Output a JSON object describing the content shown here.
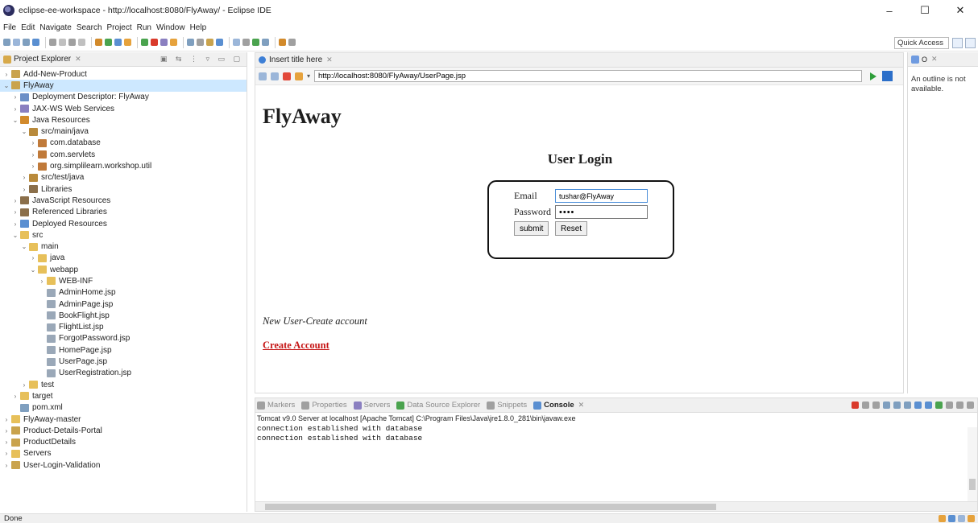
{
  "window": {
    "title": "eclipse-ee-workspace - http://localhost:8080/FlyAway/ - Eclipse IDE",
    "minimize": "–",
    "maximize": "☐",
    "close": "✕"
  },
  "menu": [
    "File",
    "Edit",
    "Navigate",
    "Search",
    "Project",
    "Run",
    "Window",
    "Help"
  ],
  "toolbar": {
    "quick_access": "Quick Access"
  },
  "project_explorer": {
    "title": "Project Explorer",
    "items": [
      {
        "label": "Add-New-Product",
        "twisty": "›",
        "icon": "project-icon"
      },
      {
        "label": "FlyAway",
        "twisty": "⌄",
        "icon": "project-icon"
      },
      {
        "label": "Deployment Descriptor: FlyAway",
        "twisty": "›",
        "icon": "descriptor-icon"
      },
      {
        "label": "JAX-WS Web Services",
        "twisty": "›",
        "icon": "web-services-icon"
      },
      {
        "label": "Java Resources",
        "twisty": "⌄",
        "icon": "java-resources-icon"
      },
      {
        "label": "src/main/java",
        "twisty": "⌄",
        "icon": "source-folder-icon"
      },
      {
        "label": "com.database",
        "twisty": "›",
        "icon": "package-icon"
      },
      {
        "label": "com.servlets",
        "twisty": "›",
        "icon": "package-icon"
      },
      {
        "label": "org.simplilearn.workshop.util",
        "twisty": "›",
        "icon": "package-icon"
      },
      {
        "label": "src/test/java",
        "twisty": "›",
        "icon": "source-folder-icon"
      },
      {
        "label": "Libraries",
        "twisty": "›",
        "icon": "library-icon"
      },
      {
        "label": "JavaScript Resources",
        "twisty": "›",
        "icon": "library-icon"
      },
      {
        "label": "Referenced Libraries",
        "twisty": "›",
        "icon": "library-icon"
      },
      {
        "label": "Deployed Resources",
        "twisty": "›",
        "icon": "deployed-icon"
      },
      {
        "label": "src",
        "twisty": "⌄",
        "icon": "folder-icon"
      },
      {
        "label": "main",
        "twisty": "⌄",
        "icon": "folder-icon"
      },
      {
        "label": "java",
        "twisty": "›",
        "icon": "folder-icon"
      },
      {
        "label": "webapp",
        "twisty": "⌄",
        "icon": "folder-icon"
      },
      {
        "label": "WEB-INF",
        "twisty": "›",
        "icon": "folder-icon"
      },
      {
        "label": "AdminHome.jsp",
        "twisty": "",
        "icon": "jsp-file-icon"
      },
      {
        "label": "AdminPage.jsp",
        "twisty": "",
        "icon": "jsp-file-icon"
      },
      {
        "label": "BookFlight.jsp",
        "twisty": "",
        "icon": "jsp-file-icon"
      },
      {
        "label": "FlightList.jsp",
        "twisty": "",
        "icon": "jsp-file-icon"
      },
      {
        "label": "ForgotPassword.jsp",
        "twisty": "",
        "icon": "jsp-file-icon"
      },
      {
        "label": "HomePage.jsp",
        "twisty": "",
        "icon": "jsp-file-icon"
      },
      {
        "label": "UserPage.jsp",
        "twisty": "",
        "icon": "jsp-file-icon"
      },
      {
        "label": "UserRegistration.jsp",
        "twisty": "",
        "icon": "jsp-file-icon"
      },
      {
        "label": "test",
        "twisty": "›",
        "icon": "folder-icon"
      },
      {
        "label": "target",
        "twisty": "›",
        "icon": "folder-icon"
      },
      {
        "label": "pom.xml",
        "twisty": "",
        "icon": "xml-file-icon"
      },
      {
        "label": "FlyAway-master",
        "twisty": "›",
        "icon": "folder-icon"
      },
      {
        "label": "Product-Details-Portal",
        "twisty": "›",
        "icon": "project-icon"
      },
      {
        "label": "ProductDetails",
        "twisty": "›",
        "icon": "project-icon"
      },
      {
        "label": "Servers",
        "twisty": "›",
        "icon": "folder-icon"
      },
      {
        "label": "User-Login-Validation",
        "twisty": "›",
        "icon": "project-icon"
      }
    ],
    "selected_index": 1
  },
  "editor": {
    "tab_title": "Insert title here",
    "url": "http://localhost:8080/FlyAway/UserPage.jsp",
    "page": {
      "heading": "FlyAway",
      "login_title": "User Login",
      "email_label": "Email",
      "email_value": "tushar@FlyAway",
      "password_label": "Password",
      "password_value": "••••",
      "submit_label": "submit",
      "reset_label": "Reset",
      "new_user_text": "New User-Create account",
      "create_account_link": "Create Account"
    }
  },
  "outline": {
    "message": "An outline is not available."
  },
  "console": {
    "tabs": [
      "Markers",
      "Properties",
      "Servers",
      "Data Source Explorer",
      "Snippets",
      "Console"
    ],
    "active_tab": "Console",
    "server_line": "Tomcat v9.0 Server at localhost [Apache Tomcat] C:\\Program Files\\Java\\jre1.8.0_281\\bin\\javaw.exe",
    "lines": [
      "connection established with database",
      "connection established with database"
    ]
  },
  "status": {
    "text": "Done"
  },
  "colors": {
    "selection": "#cde8ff",
    "link": "#c51515",
    "accent": "#3d7fd6"
  },
  "icon_colors": {
    "project-icon": "#c9a34d",
    "descriptor-icon": "#6b8fc7",
    "web-services-icon": "#8a7fc0",
    "java-resources-icon": "#d28a2b",
    "source-folder-icon": "#b98a3b",
    "package-icon": "#c07a3a",
    "library-icon": "#8b6f4a",
    "deployed-icon": "#5a8fd1",
    "folder-icon": "#e7c05a",
    "jsp-file-icon": "#9aa8b8",
    "xml-file-icon": "#7f9fbf"
  }
}
